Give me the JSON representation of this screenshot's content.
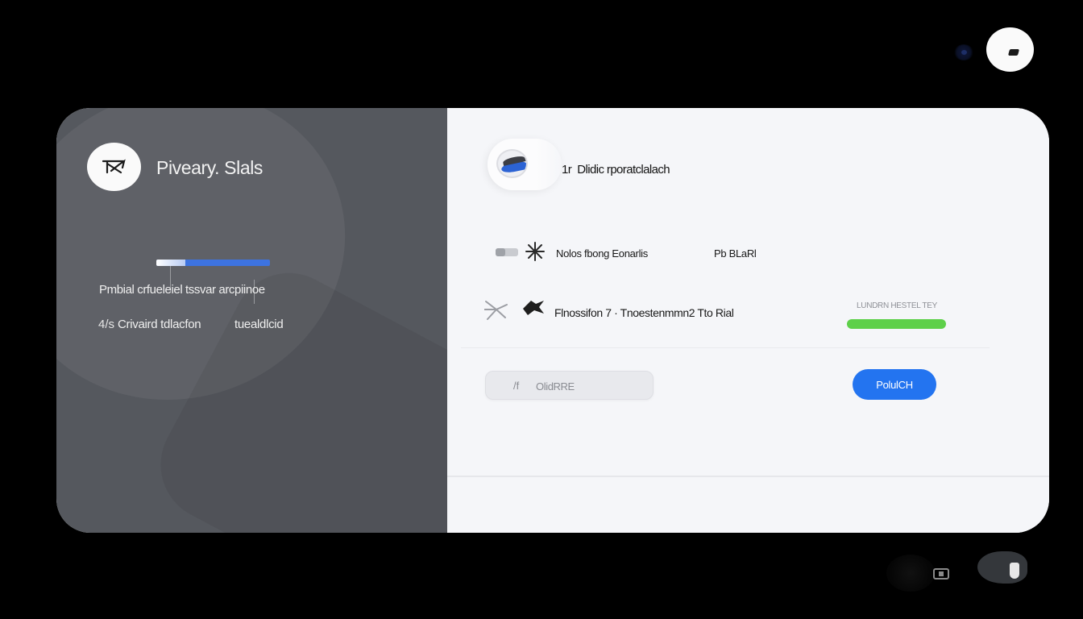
{
  "top_controls": {
    "status_dot_icon": "status-dot",
    "avatar_icon": "user-avatar"
  },
  "left_panel": {
    "title": "Piveary. Slals",
    "logo_icon": "arrow-pinwheel-icon",
    "progress": 0.25,
    "line1": "Pmbial crfueleiel tssvar arcpiinoe",
    "line2_icon_glyph": "4/s",
    "line2_label": "Crivaird tdlacfon",
    "line2_value": "tuealdlcid"
  },
  "right_panel": {
    "header_title": "Dlidic rporatclalach",
    "header_prefix": "1r",
    "row1": {
      "text": "Nolos fbong Eonarlis",
      "value": "Pb BLaRl"
    },
    "row2": {
      "text": "Flnossifon 7 · Tnoestenmmn2 Tto Rial"
    },
    "status_label": "LUNDRN HESTEL TEY",
    "status_color": "#5ed04a",
    "input_icon_glyph": "/f",
    "input_value": "OlidRRE",
    "primary_button_label": "PolulCH",
    "primary_color": "#2374f0"
  }
}
